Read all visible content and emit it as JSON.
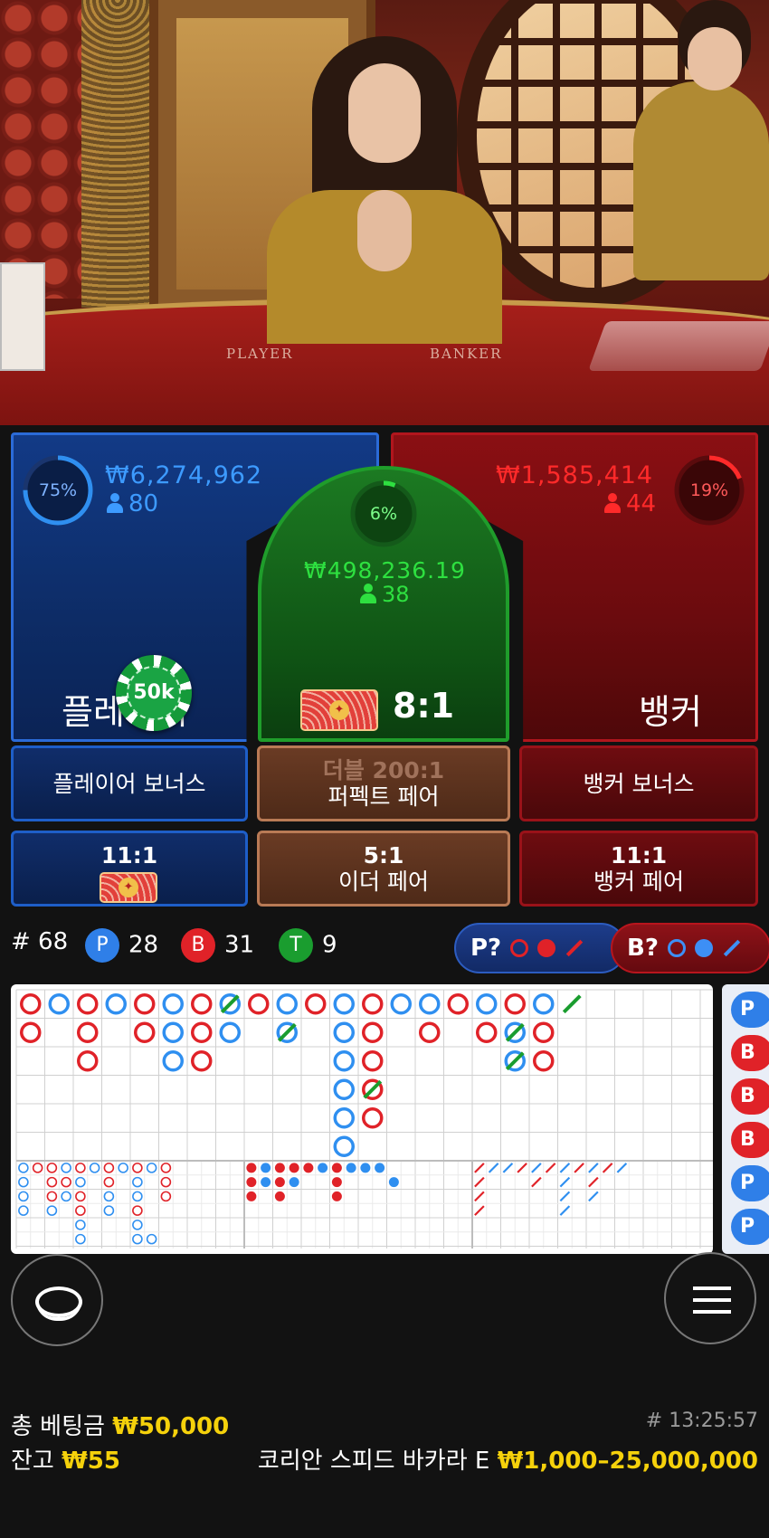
{
  "video": {
    "table_player_label": "PLAYER",
    "table_banker_label": "BANKER"
  },
  "player": {
    "percent": "75%",
    "percent_value": 75,
    "amount": "₩6,274,962",
    "players": "80",
    "label": "플레이어",
    "chip_label": "50k",
    "color": "#2f8ff0"
  },
  "tie": {
    "percent": "6%",
    "percent_value": 6,
    "amount": "₩498,236.19",
    "players": "38",
    "payout": "8:1",
    "color": "#27d13a"
  },
  "banker": {
    "percent": "19%",
    "percent_value": 19,
    "amount": "₩1,585,414",
    "players": "44",
    "label": "뱅커",
    "color": "#ff2a2a"
  },
  "side_bets": {
    "player_bonus": "플레이어 보너스",
    "perfect_pair_top": "더블 200:1",
    "perfect_pair": "퍼펙트 페어",
    "banker_bonus": "뱅커 보너스",
    "player_pair_odds": "11:1",
    "either_pair_odds": "5:1",
    "either_pair": "이더 페어",
    "banker_pair_odds": "11:1",
    "banker_pair": "뱅커 페어"
  },
  "stats": {
    "round": "# 68",
    "p_letter": "P",
    "p_count": "28",
    "b_letter": "B",
    "b_count": "31",
    "t_letter": "T",
    "t_count": "9",
    "ask_player": "P?",
    "ask_banker": "B?"
  },
  "roadmap": {
    "big_road": [
      [
        "B",
        "P",
        "B",
        "P",
        "B",
        "P",
        "B",
        "P",
        "B",
        "P",
        "B",
        "P",
        "B",
        "P",
        "P",
        "B",
        "P",
        "B",
        "P"
      ],
      [
        "B",
        "",
        "B",
        "",
        "B",
        "P",
        "B",
        "P",
        "",
        "P",
        "",
        "P",
        "B",
        "",
        "B",
        "",
        "B",
        "P",
        "B"
      ]
    ],
    "side_column": [
      "P",
      "B",
      "B",
      "B",
      "P",
      "P"
    ]
  },
  "footer": {
    "total_bet_label": "총 베팅금",
    "total_bet_value": "₩50,000",
    "balance_label": "잔고",
    "balance_value": "₩55",
    "game_id": "# 13:25:57",
    "table_name": "코리안 스피드 바카라 E",
    "limits": "₩1,000–25,000,000"
  },
  "colors": {
    "player_blue": "#2f8ff0",
    "banker_red": "#e02228",
    "tie_green": "#1a9d2f",
    "balance_yellow": "#f5d10b"
  }
}
